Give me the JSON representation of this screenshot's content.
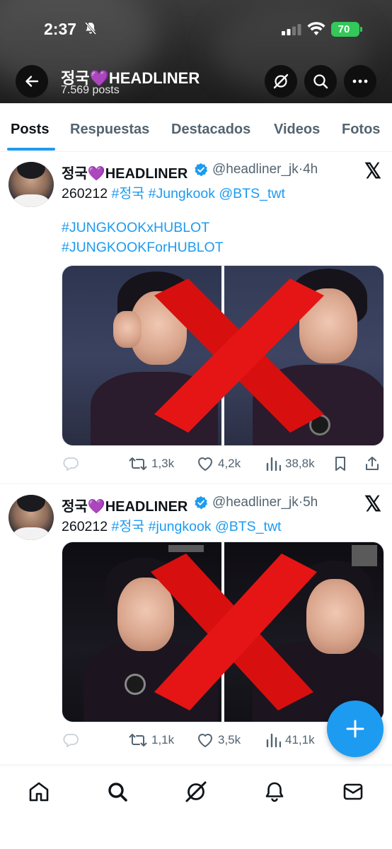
{
  "status_bar": {
    "time": "2:37",
    "battery": "70"
  },
  "header": {
    "title": "정국💜HEADLINER",
    "posts_count": "7.569 posts"
  },
  "tabs": [
    {
      "label": "Posts",
      "active": true
    },
    {
      "label": "Respuestas",
      "active": false
    },
    {
      "label": "Destacados",
      "active": false
    },
    {
      "label": "Videos",
      "active": false
    },
    {
      "label": "Fotos",
      "active": false
    }
  ],
  "tweets": [
    {
      "name": "정국💜HEADLINER",
      "handle": "@headliner_jk",
      "time": "·4h",
      "line1": {
        "plain": "260212 ",
        "tags": "#정국 #Jungkook @BTS_twt"
      },
      "line2": "#JUNGKOOKxHUBLOT",
      "line3": "#JUNGKOOKForHUBLOT",
      "retweets": "1,3k",
      "likes": "4,2k",
      "views": "38,8k"
    },
    {
      "name": "정국💜HEADLINER",
      "handle": "@headliner_jk",
      "time": "·5h",
      "line1": {
        "plain": "260212 ",
        "tags": "#정국 #jungkook @BTS_twt"
      },
      "retweets": "1,1k",
      "likes": "3,5k",
      "views": "41,1k"
    }
  ],
  "icons": {
    "back": "arrow-left-icon",
    "grok": "grok-icon",
    "search": "search-icon",
    "more": "more-icon",
    "verified": "verified-badge-icon",
    "x_logo": "x-logo-icon",
    "reply": "reply-icon",
    "retweet": "retweet-icon",
    "like": "heart-icon",
    "views": "views-icon",
    "bookmark": "bookmark-icon",
    "share": "share-icon",
    "compose": "plus-icon"
  },
  "colors": {
    "accent": "#1d9bf0",
    "verified": "#1d9bf0",
    "battery": "#34c759"
  }
}
